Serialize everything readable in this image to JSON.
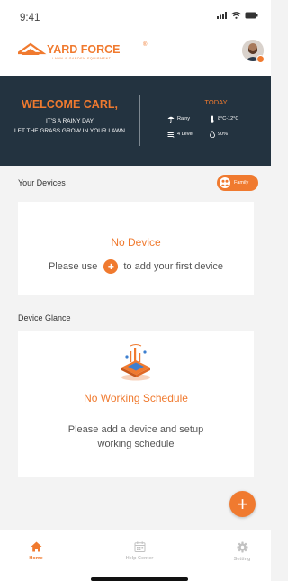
{
  "status_bar": {
    "time": "9:41"
  },
  "header": {
    "brand": "YARD FORCE",
    "brand_mark": "®",
    "tagline": "LAWN & GARDEN EQUIPMENT"
  },
  "banner": {
    "welcome": "WELCOME CARL,",
    "line1": "IT'S A RAINY DAY",
    "line2": "LET THE GRASS GROW IN YOUR LAWN",
    "today_label": "TODAY",
    "weather": [
      {
        "icon": "umbrella-icon",
        "text": "Rainy"
      },
      {
        "icon": "thermometer-icon",
        "text": "8°C-12°C"
      },
      {
        "icon": "wind-icon",
        "text": "4 Level"
      },
      {
        "icon": "humidity-drop-icon",
        "text": "90%"
      }
    ]
  },
  "devices": {
    "section_label": "Your Devices",
    "family_button": "Family",
    "empty_title": "No Device",
    "hint_before": "Please use",
    "hint_after": "to add your first device"
  },
  "glance": {
    "section_label": "Device Glance",
    "empty_title": "No Working Schedule",
    "empty_desc": "Please add a device and setup working schedule"
  },
  "fab": {
    "icon": "plus-icon"
  },
  "bottom_nav": [
    {
      "label": "Home",
      "icon": "home-icon",
      "active": true
    },
    {
      "label": "Help Center",
      "icon": "calendar-icon",
      "active": false
    },
    {
      "label": "Setting",
      "icon": "gear-icon",
      "active": false
    }
  ],
  "colors": {
    "accent": "#F07A2F",
    "banner_bg": "#233340",
    "page_bg": "#F3F3F3",
    "inactive": "#C2C2C2"
  }
}
